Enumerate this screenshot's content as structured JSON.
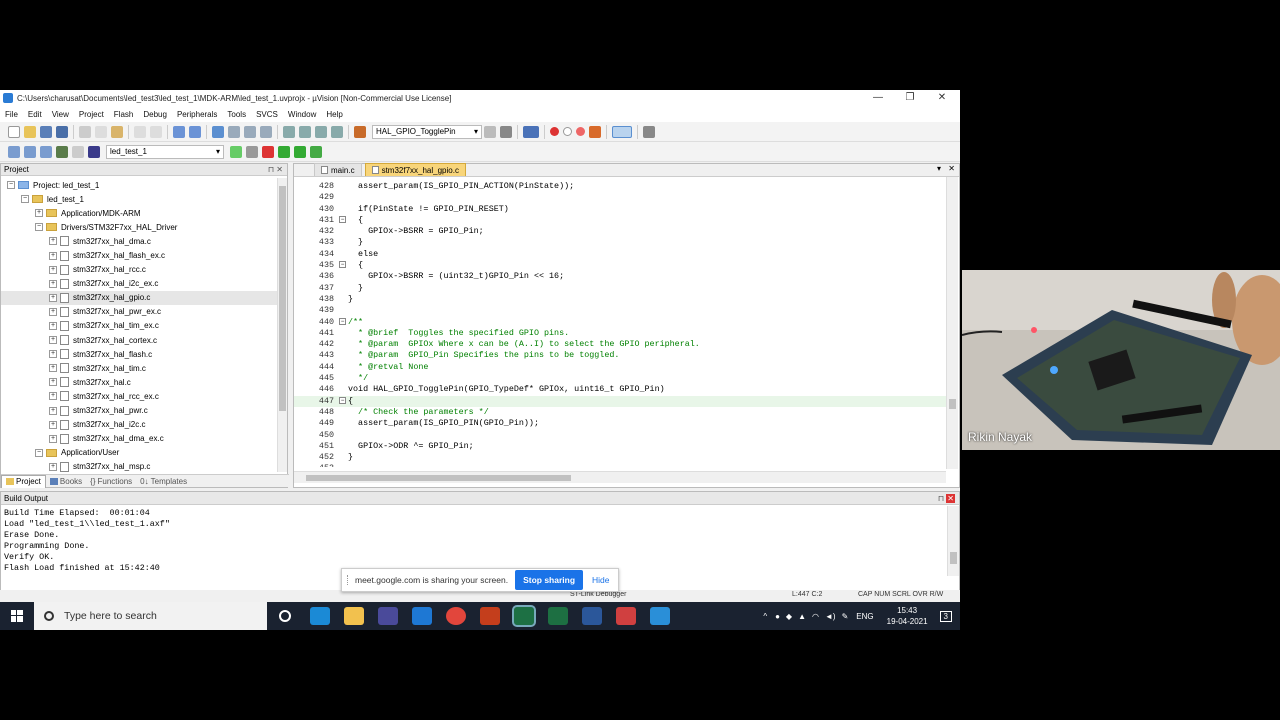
{
  "window": {
    "title": "C:\\Users\\charusat\\Documents\\led_test3\\led_test_1\\MDK-ARM\\led_test_1.uvprojx - µVision  [Non-Commercial Use License]",
    "minimize": "—",
    "maximize": "❐",
    "close": "✕"
  },
  "menu": [
    "File",
    "Edit",
    "View",
    "Project",
    "Flash",
    "Debug",
    "Peripherals",
    "Tools",
    "SVCS",
    "Window",
    "Help"
  ],
  "toolbar": {
    "function_combo": "HAL_GPIO_TogglePin",
    "target_combo": "led_test_1"
  },
  "project": {
    "header": "Project",
    "root": "Project: led_test_1",
    "target": "led_test_1",
    "items": [
      {
        "label": "Application/MDK-ARM",
        "kind": "folder",
        "expander": "+"
      },
      {
        "label": "Drivers/STM32F7xx_HAL_Driver",
        "kind": "folder",
        "expander": "−"
      },
      {
        "label": "stm32f7xx_hal_dma.c",
        "kind": "file",
        "expander": "+"
      },
      {
        "label": "stm32f7xx_hal_flash_ex.c",
        "kind": "file",
        "expander": "+"
      },
      {
        "label": "stm32f7xx_hal_rcc.c",
        "kind": "file",
        "expander": "+"
      },
      {
        "label": "stm32f7xx_hal_i2c_ex.c",
        "kind": "file",
        "expander": "+"
      },
      {
        "label": "stm32f7xx_hal_gpio.c",
        "kind": "file",
        "expander": "+",
        "selected": true
      },
      {
        "label": "stm32f7xx_hal_pwr_ex.c",
        "kind": "file",
        "expander": "+"
      },
      {
        "label": "stm32f7xx_hal_tim_ex.c",
        "kind": "file",
        "expander": "+"
      },
      {
        "label": "stm32f7xx_hal_cortex.c",
        "kind": "file",
        "expander": "+"
      },
      {
        "label": "stm32f7xx_hal_flash.c",
        "kind": "file",
        "expander": "+"
      },
      {
        "label": "stm32f7xx_hal_tim.c",
        "kind": "file",
        "expander": "+"
      },
      {
        "label": "stm32f7xx_hal.c",
        "kind": "file",
        "expander": "+"
      },
      {
        "label": "stm32f7xx_hal_rcc_ex.c",
        "kind": "file",
        "expander": "+"
      },
      {
        "label": "stm32f7xx_hal_pwr.c",
        "kind": "file",
        "expander": "+"
      },
      {
        "label": "stm32f7xx_hal_i2c.c",
        "kind": "file",
        "expander": "+"
      },
      {
        "label": "stm32f7xx_hal_dma_ex.c",
        "kind": "file",
        "expander": "+"
      },
      {
        "label": "Application/User",
        "kind": "folder",
        "expander": "−"
      },
      {
        "label": "stm32f7xx_hal_msp.c",
        "kind": "file",
        "expander": "+"
      }
    ],
    "tabs": [
      "Project",
      "Books",
      "Functions",
      "Templates"
    ]
  },
  "editor": {
    "tabs": [
      "main.c",
      "stm32f7xx_hal_gpio.c"
    ],
    "lines": [
      {
        "n": "428",
        "t": "  assert_param(IS_GPIO_PIN_ACTION(PinState));"
      },
      {
        "n": "429",
        "t": ""
      },
      {
        "n": "430",
        "t": "  if(PinState != GPIO_PIN_RESET)"
      },
      {
        "n": "431",
        "t": "  {",
        "fold": "−"
      },
      {
        "n": "432",
        "t": "    GPIOx->BSRR = GPIO_Pin;"
      },
      {
        "n": "433",
        "t": "  }"
      },
      {
        "n": "434",
        "t": "  else"
      },
      {
        "n": "435",
        "t": "  {",
        "fold": "−"
      },
      {
        "n": "436",
        "t": "    GPIOx->BSRR = (uint32_t)GPIO_Pin << 16;"
      },
      {
        "n": "437",
        "t": "  }"
      },
      {
        "n": "438",
        "t": "}"
      },
      {
        "n": "439",
        "t": ""
      },
      {
        "n": "440",
        "t": "/**",
        "fold": "−",
        "comment": true
      },
      {
        "n": "441",
        "t": "  * @brief  Toggles the specified GPIO pins.",
        "comment": true
      },
      {
        "n": "442",
        "t": "  * @param  GPIOx Where x can be (A..I) to select the GPIO peripheral.",
        "comment": true
      },
      {
        "n": "443",
        "t": "  * @param  GPIO_Pin Specifies the pins to be toggled.",
        "comment": true
      },
      {
        "n": "444",
        "t": "  * @retval None",
        "comment": true
      },
      {
        "n": "445",
        "t": "  */",
        "comment": true
      },
      {
        "n": "446",
        "t": "void HAL_GPIO_TogglePin(GPIO_TypeDef* GPIOx, uint16_t GPIO_Pin)"
      },
      {
        "n": "447",
        "t": "{",
        "fold": "−",
        "current": true
      },
      {
        "n": "448",
        "t": "  /* Check the parameters */",
        "comment": true
      },
      {
        "n": "449",
        "t": "  assert_param(IS_GPIO_PIN(GPIO_Pin));"
      },
      {
        "n": "450",
        "t": ""
      },
      {
        "n": "451",
        "t": "  GPIOx->ODR ^= GPIO_Pin;"
      },
      {
        "n": "452",
        "t": "}"
      },
      {
        "n": "453",
        "t": ""
      }
    ]
  },
  "build": {
    "header": "Build Output",
    "lines": [
      "Build Time Elapsed:  00:01:04",
      "Load \"led_test_1\\\\led_test_1.axf\"",
      "Erase Done.",
      "Programming Done.",
      "Verify OK.",
      "Flash Load finished at 15:42:40"
    ]
  },
  "status": {
    "debugger": "ST-Link Debugger",
    "position": "L:447 C:2",
    "flags": "CAP  NUM  SCRL  OVR  R/W"
  },
  "share_bar": {
    "message": "meet.google.com is sharing your screen.",
    "stop": "Stop sharing",
    "hide": "Hide"
  },
  "taskbar": {
    "search_placeholder": "Type here to search",
    "lang": "ENG",
    "time": "15:43",
    "date": "19-04-2021",
    "notifications": "3"
  },
  "participant": {
    "name": "Rikin Nayak"
  },
  "colors": {
    "accent": "#1a73e8",
    "active_tab": "#f8d57a",
    "comment": "#008000",
    "taskbar": "#1a2230"
  }
}
